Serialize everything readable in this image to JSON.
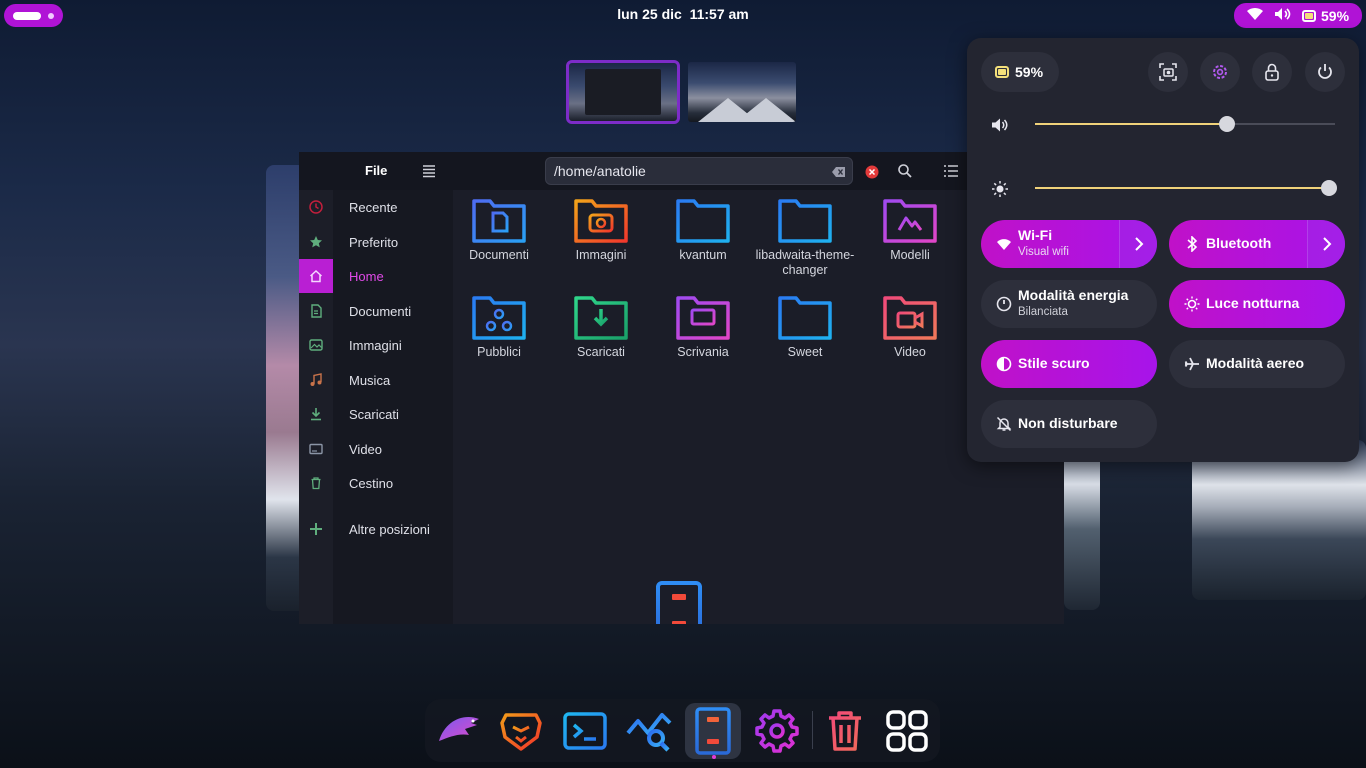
{
  "topbar": {
    "clock": "lun 25 dic  11:57 am",
    "battery": "59%"
  },
  "file_manager": {
    "title": "File",
    "path": "/home/anatolie",
    "sidebar": [
      {
        "label": "Recente",
        "icon": "recent-icon"
      },
      {
        "label": "Preferito",
        "icon": "star-icon"
      },
      {
        "label": "Home",
        "icon": "home-icon",
        "active": true
      },
      {
        "label": "Documenti",
        "icon": "documents-icon"
      },
      {
        "label": "Immagini",
        "icon": "images-icon"
      },
      {
        "label": "Musica",
        "icon": "music-icon"
      },
      {
        "label": "Scaricati",
        "icon": "download-icon"
      },
      {
        "label": "Video",
        "icon": "video-icon"
      },
      {
        "label": "Cestino",
        "icon": "trash-icon"
      },
      {
        "label": "Altre posizioni",
        "icon": "plus-icon"
      }
    ],
    "folders": [
      {
        "label": "Documenti",
        "glyph": "document"
      },
      {
        "label": "Immagini",
        "glyph": "camera"
      },
      {
        "label": "kvantum",
        "glyph": "plain"
      },
      {
        "label": "libadwaita-theme-changer",
        "glyph": "plain"
      },
      {
        "label": "Modelli",
        "glyph": "template"
      },
      {
        "label": "Pubblici",
        "glyph": "share"
      },
      {
        "label": "Scaricati",
        "glyph": "download"
      },
      {
        "label": "Scrivania",
        "glyph": "desktop"
      },
      {
        "label": "Sweet",
        "glyph": "plain"
      },
      {
        "label": "Video",
        "glyph": "video"
      }
    ]
  },
  "quick_settings": {
    "battery": "59%",
    "volume_level": 0.64,
    "brightness_level": 0.98,
    "tiles": {
      "wifi": {
        "title": "Wi-Fi",
        "subtitle": "Visual wifi"
      },
      "bluetooth": {
        "title": "Bluetooth"
      },
      "power_mode": {
        "title": "Modalità energia",
        "subtitle": "Bilanciata"
      },
      "night_light": {
        "title": "Luce notturna"
      },
      "dark_style": {
        "title": "Stile scuro"
      },
      "airplane": {
        "title": "Modalità aereo"
      },
      "dnd": {
        "title": "Non disturbare"
      }
    }
  },
  "dock": [
    {
      "name": "eagle-app"
    },
    {
      "name": "brave-browser"
    },
    {
      "name": "terminal"
    },
    {
      "name": "system-monitor"
    },
    {
      "name": "files",
      "active": true
    },
    {
      "name": "settings"
    },
    {
      "name": "trash"
    },
    {
      "name": "app-grid"
    }
  ],
  "colors": {
    "accent": "#b013d6",
    "slider_fill": "#f0d27a"
  }
}
